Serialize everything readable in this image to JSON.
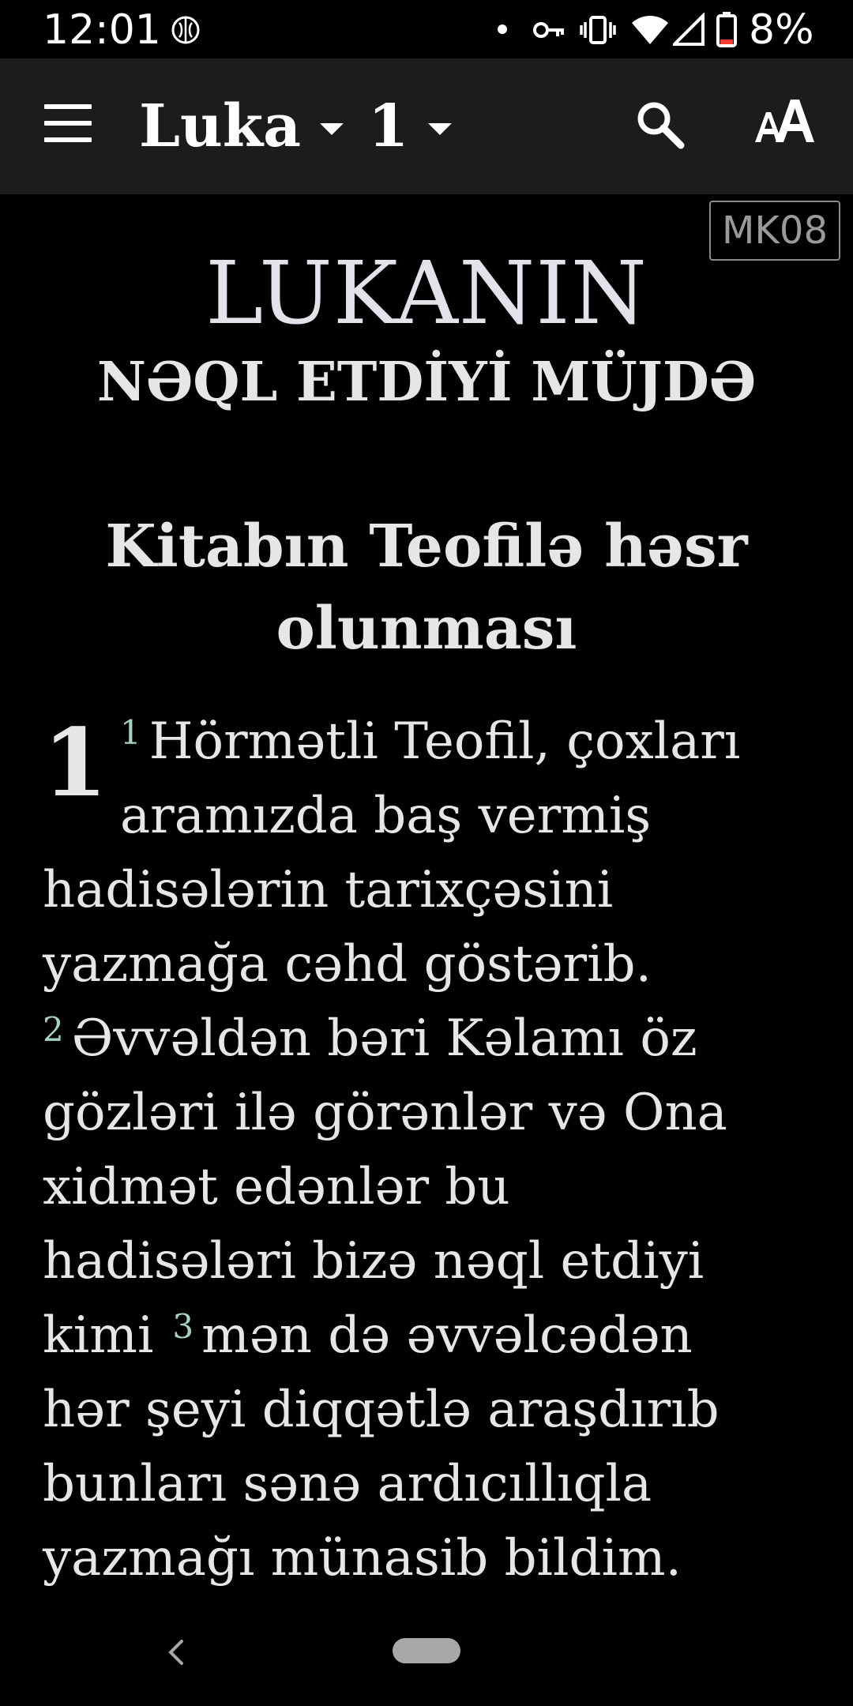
{
  "status_bar": {
    "time": "12:01",
    "battery": "8%",
    "icons": [
      "brain-icon",
      "notification-dot-icon",
      "key-icon",
      "vibrate-icon",
      "wifi-icon",
      "signal-icon",
      "battery-icon"
    ]
  },
  "app_bar": {
    "book": "Luka",
    "chapter": "1",
    "icons": [
      "menu-icon",
      "caret-down-icon",
      "search-icon",
      "text-size-icon"
    ]
  },
  "content": {
    "version": "MK08",
    "title_line1": "LUKANIN",
    "title_line2": "NƏQL ETDİYİ MÜJDƏ",
    "heading": "Kitabın Teofilə həsr olunması",
    "chapter_number": "1",
    "verses": {
      "v1": "1",
      "v2": "2",
      "v3": "3"
    },
    "lines": [
      "Hörmətli Teofil, çoxları",
      "aramızda baş vermiş",
      "hadisələrin tarixçəsini",
      "yazmağa cəhd göstərib.",
      "Əvvəldən bəri Kəlamı öz",
      "gözləri ilə görənlər və Ona",
      "xidmət edənlər bu",
      "hadisələri bizə nəql etdiyi",
      "kimi",
      "mən də əvvəlcədən",
      "hər şeyi diqqətlə araşdırıb",
      "bunları sənə ardıcıllıqla",
      "yazmağı münasib bildim."
    ]
  },
  "nav_bar": {
    "icons": [
      "back-icon",
      "home-pill-icon"
    ]
  },
  "colors": {
    "background": "#000000",
    "app_bar": "#1c1c1e",
    "text": "#e6e6e6",
    "verse_number": "#a6d4c2",
    "badge_border": "#8a8a8a"
  }
}
